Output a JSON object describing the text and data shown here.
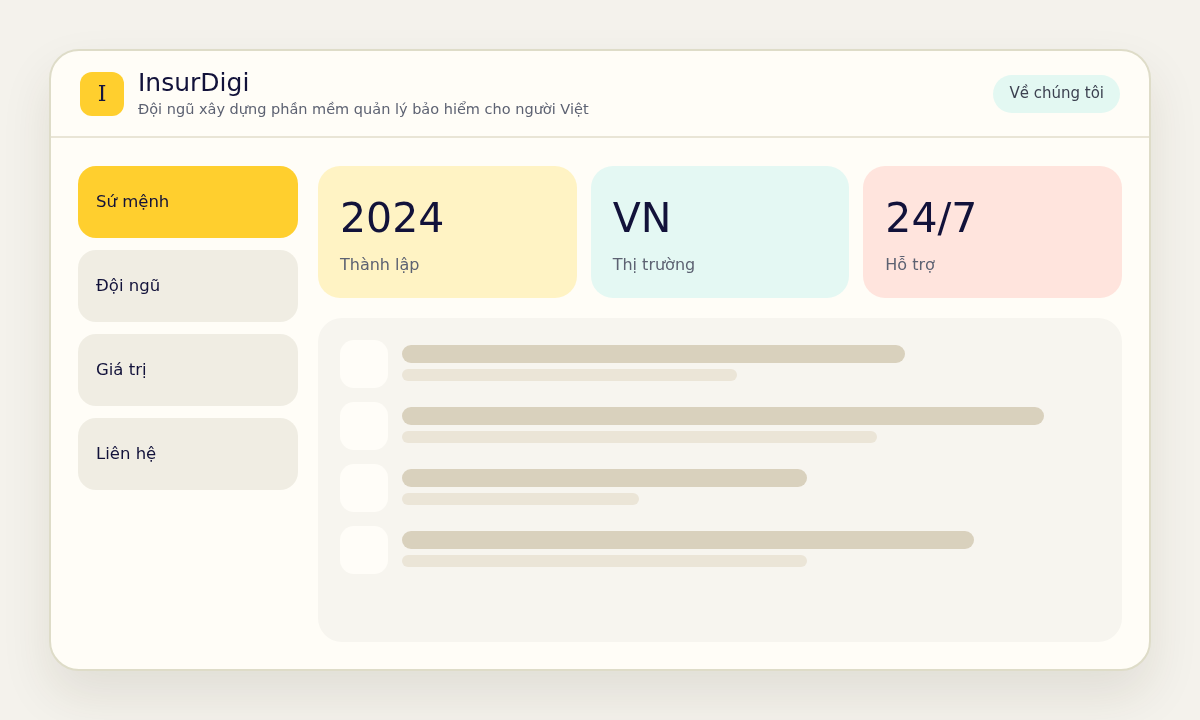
{
  "header": {
    "logo_letter": "I",
    "title": "InsurDigi",
    "subtitle": "Đội ngũ xây dựng phần mềm quản lý bảo hiểm cho người Việt",
    "about_button": "Về chúng tôi"
  },
  "nav": [
    {
      "label": "Sứ mệnh",
      "selected": true
    },
    {
      "label": "Đội ngũ",
      "selected": false
    },
    {
      "label": "Giá trị",
      "selected": false
    },
    {
      "label": "Liên hệ",
      "selected": false
    }
  ],
  "stats": [
    {
      "value": "2024",
      "label": "Thành lập",
      "color": "#fff3c4"
    },
    {
      "value": "VN",
      "label": "Thị trường",
      "color": "#e4f8f3"
    },
    {
      "value": "24/7",
      "label": "Hỗ trợ",
      "color": "#ffe4dd"
    }
  ]
}
